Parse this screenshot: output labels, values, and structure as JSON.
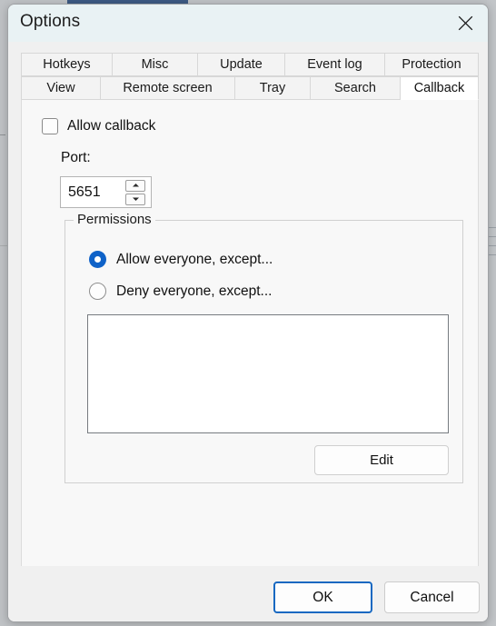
{
  "window": {
    "title": "Options",
    "close_icon": "close-icon"
  },
  "tabs": {
    "row1": [
      {
        "label": "Hotkeys",
        "selected": false
      },
      {
        "label": "Misc",
        "selected": false
      },
      {
        "label": "Update",
        "selected": false
      },
      {
        "label": "Event log",
        "selected": false
      },
      {
        "label": "Protection",
        "selected": false
      }
    ],
    "row2": [
      {
        "label": "View",
        "selected": false
      },
      {
        "label": "Remote screen",
        "selected": false
      },
      {
        "label": "Tray",
        "selected": false
      },
      {
        "label": "Search",
        "selected": false
      },
      {
        "label": "Callback",
        "selected": true
      }
    ]
  },
  "page": {
    "allow_callback": {
      "label": "Allow callback",
      "checked": false
    },
    "port": {
      "label": "Port:",
      "value": "5651",
      "spin_up_icon": "caret-up-icon",
      "spin_down_icon": "caret-down-icon"
    },
    "permissions": {
      "legend": "Permissions",
      "options": [
        {
          "label": "Allow everyone, except...",
          "selected": true
        },
        {
          "label": "Deny everyone, except...",
          "selected": false
        }
      ],
      "list_items": [],
      "edit_label": "Edit"
    }
  },
  "footer": {
    "ok_label": "OK",
    "cancel_label": "Cancel"
  },
  "colors": {
    "accent": "#0f62c8",
    "focus_border": "#1668c1",
    "titlebar": "#e9f2f4",
    "dialog_bg": "#f0f0f0",
    "page_bg": "#f8f8f8"
  }
}
